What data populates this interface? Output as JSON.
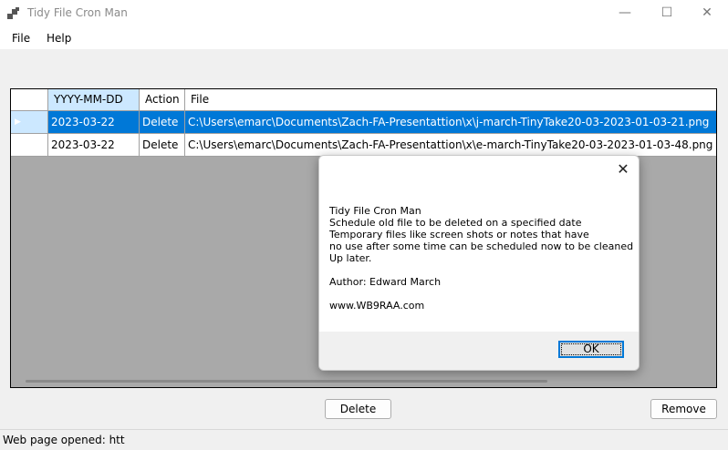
{
  "window": {
    "title": "Tidy File Cron Man",
    "minimize_glyph": "—",
    "maximize_glyph": "☐",
    "close_glyph": "✕"
  },
  "menu": {
    "file": "File",
    "help": "Help"
  },
  "grid": {
    "columns": [
      "YYYY-MM-DD",
      "Action",
      "File"
    ],
    "rows": [
      {
        "date": "2023-03-22",
        "action": "Delete",
        "file": "C:\\Users\\emarc\\Documents\\Zach-FA-Presentattion\\x\\j-march-TinyTake20-03-2023-01-03-21.png",
        "selected": true
      },
      {
        "date": "2023-03-22",
        "action": "Delete",
        "file": "C:\\Users\\emarc\\Documents\\Zach-FA-Presentattion\\x\\e-march-TinyTake20-03-2023-01-03-48.png",
        "selected": false
      }
    ],
    "current_row_glyph": "▶"
  },
  "dialog": {
    "close_glyph": "✕",
    "lines": [
      "Tidy File Cron Man",
      "Schedule old file to be deleted on a specified date",
      "Temporary files like screen shots or notes that have",
      "no use after some time can be scheduled now to be cleaned",
      "Up later."
    ],
    "author": "Author: Edward March",
    "website": "www.WB9RAA.com",
    "ok_label": "OK"
  },
  "buttons": {
    "delete": "Delete",
    "remove": "Remove"
  },
  "status": {
    "text": "Web page opened: htt"
  },
  "colors": {
    "selection": "#0078d7",
    "selected_header": "#cce8ff",
    "grid_background": "#a9a9a9"
  },
  "icons": {
    "app": "app-window-icon"
  }
}
